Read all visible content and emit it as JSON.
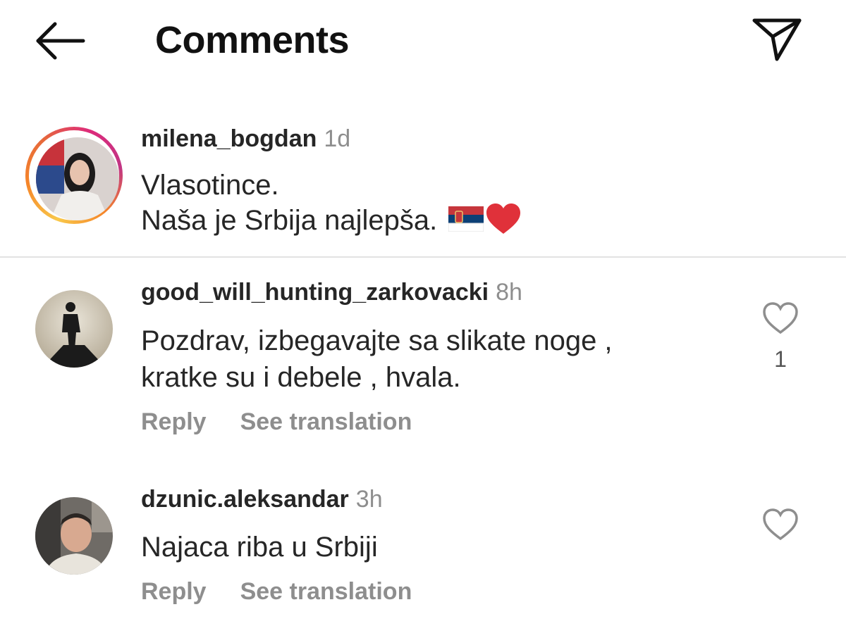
{
  "header": {
    "title": "Comments",
    "back_icon": "arrow-left-icon",
    "send_icon": "paper-plane-icon"
  },
  "caption": {
    "username": "milena_bogdan",
    "time": "1d",
    "line1": "Vlasotince.",
    "line2": "Naša je Srbija najlepša.",
    "emojis": [
      "serbia-flag-icon",
      "red-heart-icon"
    ]
  },
  "comments": [
    {
      "username": "good_will_hunting_zarkovacki",
      "time": "8h",
      "line1": "Pozdrav, izbegavajte sa slikate noge ,",
      "line2": "kratke su i debele , hvala.",
      "reply": "Reply",
      "translate": "See translation",
      "likes": "1"
    },
    {
      "username": "dzunic.aleksandar",
      "time": "3h",
      "line1": "Najaca riba u Srbiji",
      "reply": "Reply",
      "translate": "See translation"
    }
  ],
  "colors": {
    "text": "#262626",
    "muted": "#8e8e8e",
    "divider": "#e2e2e2",
    "heart": "#e0313a"
  }
}
